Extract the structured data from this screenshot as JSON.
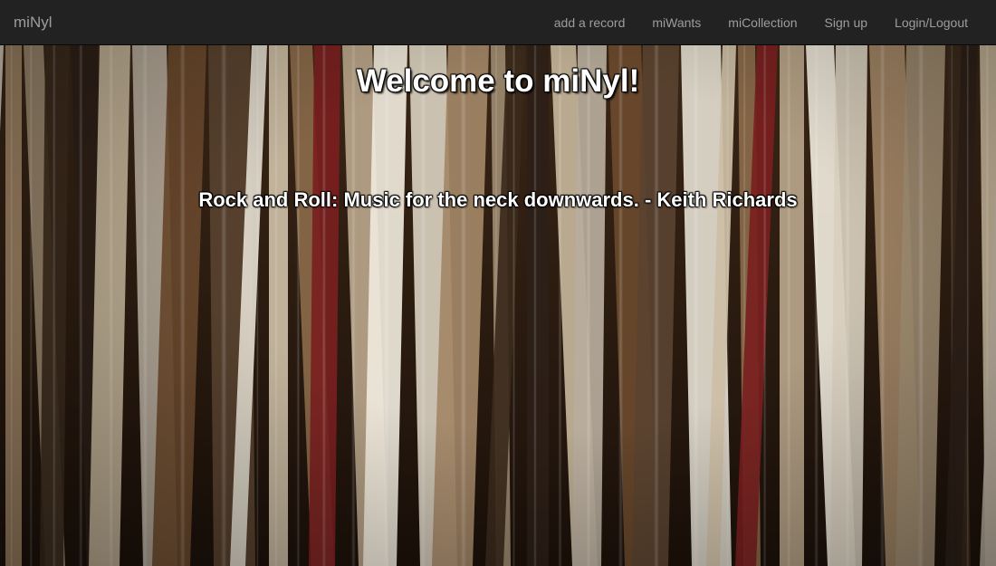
{
  "nav": {
    "brand": "miNyl",
    "links": [
      {
        "label": "add a record"
      },
      {
        "label": "miWants"
      },
      {
        "label": "miCollection"
      },
      {
        "label": "Sign up"
      },
      {
        "label": "Login/Logout"
      }
    ]
  },
  "hero": {
    "title": "Welcome to miNyl!",
    "quote": "Rock and Roll: Music for the neck downwards. - Keith Richards",
    "background_image": "record-shelf-photo"
  },
  "colors": {
    "navbar_bg": "#222222",
    "nav_text": "#9d9d9d",
    "hero_text": "#ffffff"
  }
}
